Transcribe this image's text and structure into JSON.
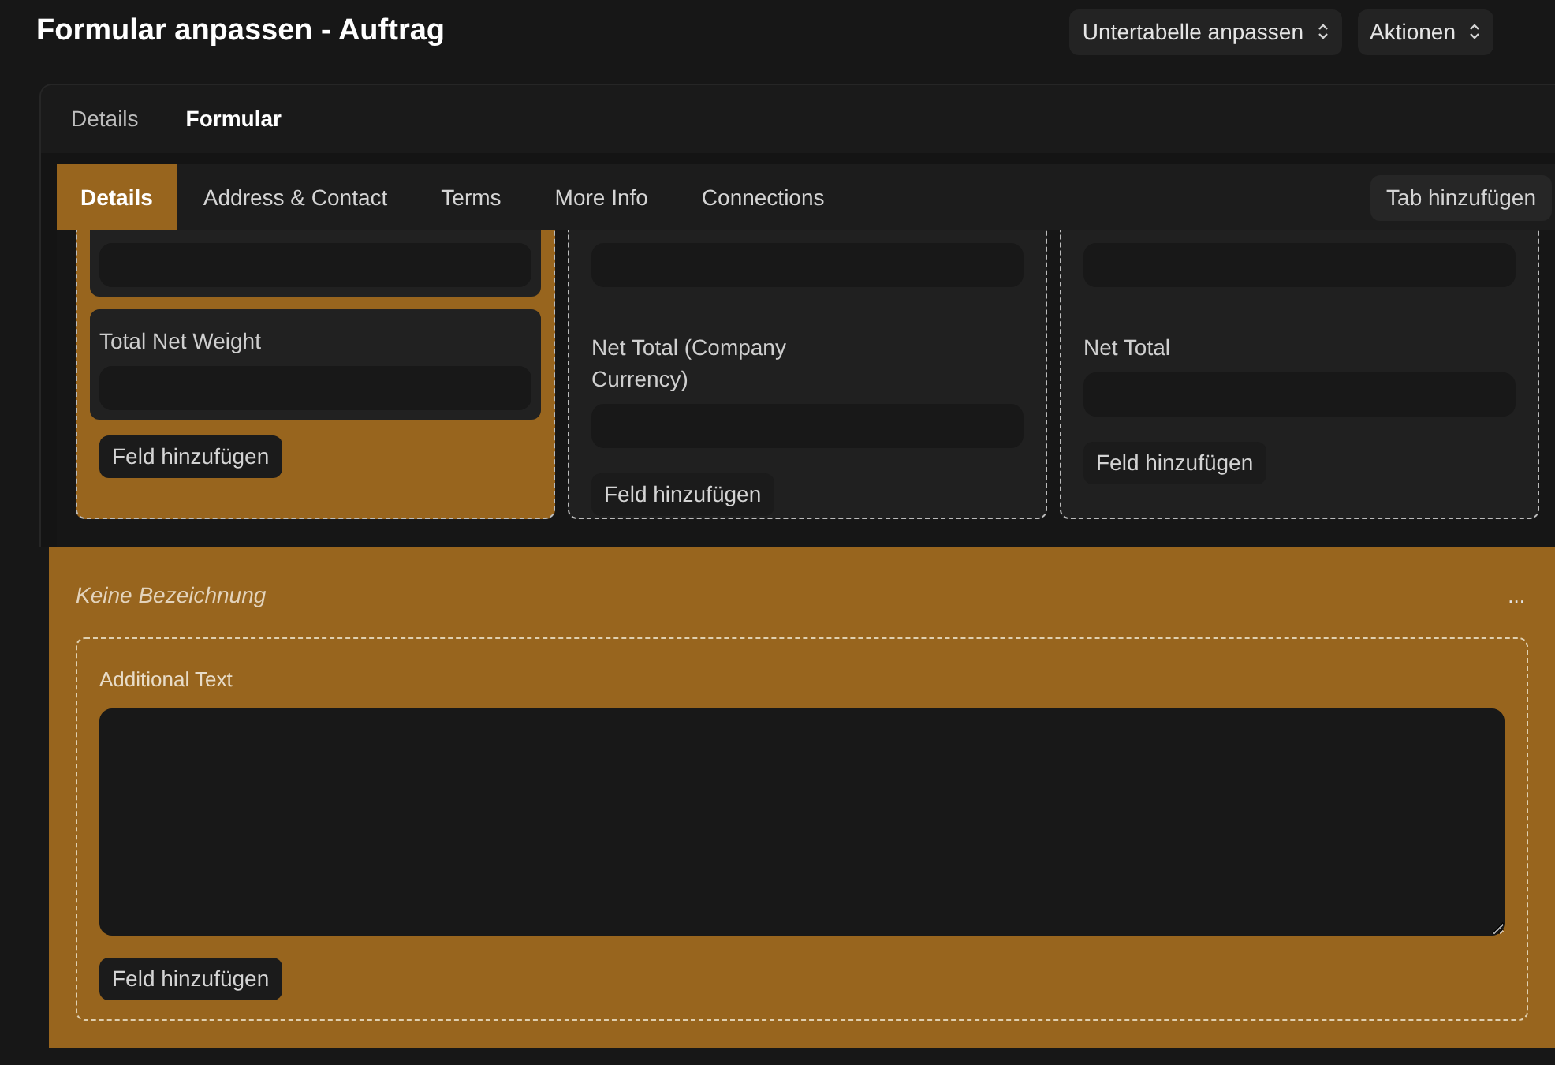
{
  "header": {
    "title": "Formular anpassen - Auftrag",
    "buttons": [
      {
        "label": "Untertabelle anpassen"
      },
      {
        "label": "Aktionen"
      }
    ]
  },
  "view_tabs": [
    {
      "label": "Details",
      "selected": false
    },
    {
      "label": "Formular",
      "selected": true
    }
  ],
  "form_tabs": [
    {
      "label": "Details",
      "selected": true
    },
    {
      "label": "Address & Contact",
      "selected": false
    },
    {
      "label": "Terms",
      "selected": false
    },
    {
      "label": "More Info",
      "selected": false
    },
    {
      "label": "Connections",
      "selected": false
    }
  ],
  "add_tab_button": "Tab hinzufügen",
  "columns": [
    {
      "selected": true,
      "fields": [
        {
          "kind": "input"
        },
        {
          "kind": "labeled",
          "label": "Total Net Weight"
        }
      ],
      "add_field": "Feld hinzufügen"
    },
    {
      "selected": false,
      "fields": [
        {
          "kind": "input"
        },
        {
          "kind": "labeled",
          "label": "Net Total (Company Currency)"
        }
      ],
      "add_field": "Feld hinzufügen"
    },
    {
      "selected": false,
      "fields": [
        {
          "kind": "input"
        },
        {
          "kind": "labeled",
          "label": "Net Total"
        }
      ],
      "add_field": "Feld hinzufügen"
    }
  ],
  "section": {
    "selected": true,
    "label": "Keine Bezeichnung",
    "menu": "...",
    "field": {
      "label": "Additional Text"
    },
    "add_field": "Feld hinzufügen"
  }
}
